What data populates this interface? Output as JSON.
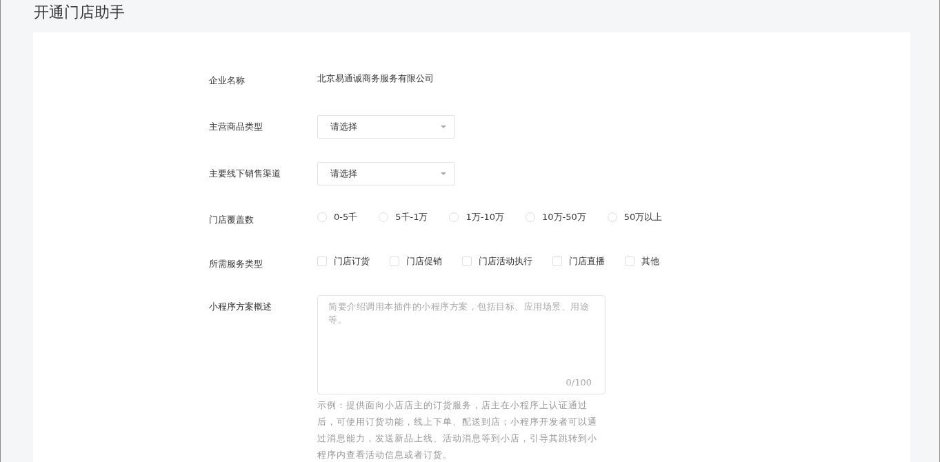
{
  "page": {
    "title": "开通门店助手"
  },
  "form": {
    "company": {
      "label": "企业名称",
      "value": "北京易通诚商务服务有限公司"
    },
    "product_type": {
      "label": "主营商品类型",
      "placeholder": "请选择"
    },
    "sales_channel": {
      "label": "主要线下销售渠道",
      "placeholder": "请选择"
    },
    "store_coverage": {
      "label": "门店覆盖数",
      "options": [
        {
          "label": "0-5千",
          "selected": false
        },
        {
          "label": "5千-1万",
          "selected": false
        },
        {
          "label": "1万-10万",
          "selected": false
        },
        {
          "label": "10万-50万",
          "selected": false
        },
        {
          "label": "50万以上",
          "selected": false
        }
      ]
    },
    "service_types": {
      "label": "所需服务类型",
      "options": [
        {
          "label": "门店订货",
          "checked": false
        },
        {
          "label": "门店促销",
          "checked": false
        },
        {
          "label": "门店活动执行",
          "checked": false
        },
        {
          "label": "门店直播",
          "checked": false
        },
        {
          "label": "其他",
          "checked": false
        }
      ]
    },
    "summary": {
      "label": "小程序方案概述",
      "placeholder": "简要介绍调用本插件的小程序方案，包括目标、应用场景、用途等。",
      "counter": "0/100",
      "hint": "示例：提供面向小店店主的订货服务，店主在小程序上认证通过后，可使用订货功能，线上下单、配送到店；小程序开发者可以通过消息能力，发送新品上线、活动消息等到小店，引导其跳转到小程序内查看活动信息或者订货。"
    }
  }
}
